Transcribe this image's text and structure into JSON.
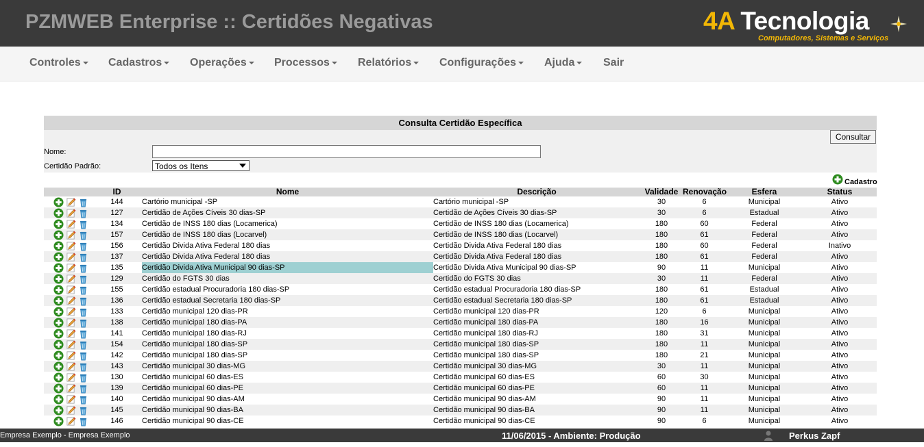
{
  "header": {
    "title": "PZMWEB Enterprise :: Certidões Negativas"
  },
  "logo": {
    "brand_a": "4A",
    "brand_b": "Tecnologia",
    "tagline": "Computadores, Sistemas e Serviços",
    "accent_color": "#f2b705"
  },
  "menu": [
    {
      "label": "Controles",
      "has_dropdown": true
    },
    {
      "label": "Cadastros",
      "has_dropdown": true
    },
    {
      "label": "Operações",
      "has_dropdown": true
    },
    {
      "label": "Processos",
      "has_dropdown": true
    },
    {
      "label": "Relatórios",
      "has_dropdown": true
    },
    {
      "label": "Configurações",
      "has_dropdown": true
    },
    {
      "label": "Ajuda",
      "has_dropdown": true
    },
    {
      "label": "Sair",
      "has_dropdown": false
    }
  ],
  "panel": {
    "title": "Consulta Certidão Específica",
    "consultar_label": "Consultar",
    "nome_label": "Nome:",
    "nome_value": "",
    "padrao_label": "Certidão Padrão:",
    "padrao_selected": "Todos os Itens",
    "cadastro_label": "Cadastro"
  },
  "table": {
    "columns": [
      "",
      "ID",
      "Nome",
      "Descrição",
      "Validade",
      "Renovação",
      "Esfera",
      "Status"
    ],
    "highlight_color": "#9ed0d2",
    "row_icons": [
      "add-icon",
      "edit-pencil-icon",
      "trash-icon"
    ],
    "rows": [
      {
        "id": "144",
        "nome": "Cartório municipal -SP",
        "descricao": "Cartório municipal -SP",
        "validade": "30",
        "renovacao": "6",
        "esfera": "Municipal",
        "status": "Ativo"
      },
      {
        "id": "127",
        "nome": "Certidão de Ações Cíveis 30 dias-SP",
        "descricao": "Certidão de Ações Cíveis 30 dias-SP",
        "validade": "30",
        "renovacao": "6",
        "esfera": "Estadual",
        "status": "Ativo"
      },
      {
        "id": "134",
        "nome": "Certidão de INSS 180 dias (Locamerica)",
        "descricao": "Certidão de INSS 180 dias (Locamerica)",
        "validade": "180",
        "renovacao": "60",
        "esfera": "Federal",
        "status": "Ativo"
      },
      {
        "id": "157",
        "nome": "Certidão de INSS 180 dias (Locarvel)",
        "descricao": "Certidão de INSS 180 dias (Locarvel)",
        "validade": "180",
        "renovacao": "61",
        "esfera": "Federal",
        "status": "Ativo"
      },
      {
        "id": "156",
        "nome": "Certidão Divida Ativa Federal 180 dias",
        "descricao": "Certidão Divida Ativa Federal 180 dias",
        "validade": "180",
        "renovacao": "60",
        "esfera": "Federal",
        "status": "Inativo"
      },
      {
        "id": "137",
        "nome": "Certidão Divida Ativa Federal 180 dias",
        "descricao": "Certidão Divida Ativa Federal 180 dias",
        "validade": "180",
        "renovacao": "61",
        "esfera": "Federal",
        "status": "Ativo"
      },
      {
        "id": "135",
        "nome": "Certidão Divida Ativa Municipal 90 dias-SP",
        "descricao": "Certidão Divida Ativa Municipal 90 dias-SP",
        "validade": "90",
        "renovacao": "11",
        "esfera": "Municipal",
        "status": "Ativo",
        "highlight": true
      },
      {
        "id": "129",
        "nome": "Certidão do FGTS 30 dias",
        "descricao": "Certidão do FGTS 30 dias",
        "validade": "30",
        "renovacao": "11",
        "esfera": "Federal",
        "status": "Ativo"
      },
      {
        "id": "155",
        "nome": "Certidão estadual Procuradoria 180 dias-SP",
        "descricao": "Certidão estadual Procuradoria 180 dias-SP",
        "validade": "180",
        "renovacao": "61",
        "esfera": "Estadual",
        "status": "Ativo"
      },
      {
        "id": "136",
        "nome": "Certidão estadual Secretaria 180 dias-SP",
        "descricao": "Certidão estadual Secretaria 180 dias-SP",
        "validade": "180",
        "renovacao": "61",
        "esfera": "Estadual",
        "status": "Ativo"
      },
      {
        "id": "133",
        "nome": "Certidão municipal 120 dias-PR",
        "descricao": "Certidão municipal 120 dias-PR",
        "validade": "120",
        "renovacao": "6",
        "esfera": "Municipal",
        "status": "Ativo"
      },
      {
        "id": "138",
        "nome": "Certidão municipal 180 dias-PA",
        "descricao": "Certidão municipal 180 dias-PA",
        "validade": "180",
        "renovacao": "16",
        "esfera": "Municipal",
        "status": "Ativo"
      },
      {
        "id": "141",
        "nome": "Certidão municipal 180 dias-RJ",
        "descricao": "Certidão municipal 180 dias-RJ",
        "validade": "180",
        "renovacao": "31",
        "esfera": "Municipal",
        "status": "Ativo"
      },
      {
        "id": "154",
        "nome": "Certidão municipal 180 dias-SP",
        "descricao": "Certidão municipal 180 dias-SP",
        "validade": "180",
        "renovacao": "11",
        "esfera": "Municipal",
        "status": "Ativo"
      },
      {
        "id": "142",
        "nome": "Certidão municipal 180 dias-SP",
        "descricao": "Certidão municipal 180 dias-SP",
        "validade": "180",
        "renovacao": "21",
        "esfera": "Municipal",
        "status": "Ativo"
      },
      {
        "id": "143",
        "nome": "Certidão municipal 30 dias-MG",
        "descricao": "Certidão municipal 30 dias-MG",
        "validade": "30",
        "renovacao": "11",
        "esfera": "Municipal",
        "status": "Ativo"
      },
      {
        "id": "130",
        "nome": "Certidão municipal 60 dias-ES",
        "descricao": "Certidão municipal 60 dias-ES",
        "validade": "60",
        "renovacao": "30",
        "esfera": "Municipal",
        "status": "Ativo"
      },
      {
        "id": "139",
        "nome": "Certidão municipal 60 dias-PE",
        "descricao": "Certidão municipal 60 dias-PE",
        "validade": "60",
        "renovacao": "11",
        "esfera": "Municipal",
        "status": "Ativo"
      },
      {
        "id": "140",
        "nome": "Certidão municipal 90 dias-AM",
        "descricao": "Certidão municipal 90 dias-AM",
        "validade": "90",
        "renovacao": "11",
        "esfera": "Municipal",
        "status": "Ativo"
      },
      {
        "id": "145",
        "nome": "Certidão municipal 90 dias-BA",
        "descricao": "Certidão municipal 90 dias-BA",
        "validade": "90",
        "renovacao": "11",
        "esfera": "Municipal",
        "status": "Ativo"
      },
      {
        "id": "146",
        "nome": "Certidão municipal 90 dias-CE",
        "descricao": "Certidão municipal 90 dias-CE",
        "validade": "90",
        "renovacao": "6",
        "esfera": "Municipal",
        "status": "Ativo"
      }
    ]
  },
  "footer": {
    "company": "Empresa Exemplo - Empresa Exemplo",
    "date_env": "11/06/2015 - Ambiente: Produção",
    "user": "Perkus Zapf"
  }
}
